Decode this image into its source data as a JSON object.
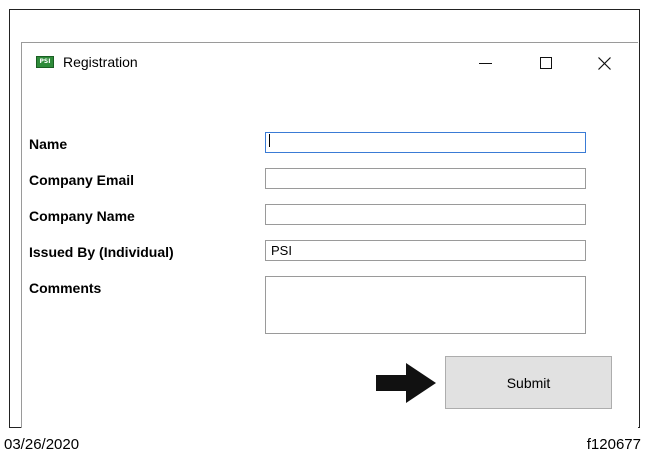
{
  "window": {
    "title": "Registration",
    "icon": "psi-app-icon",
    "icon_text": "PSI",
    "controls": {
      "minimize": "minimize-icon",
      "maximize": "maximize-icon",
      "close": "close-icon",
      "close_glyph": "✕"
    }
  },
  "form": {
    "fields": [
      {
        "label": "Name",
        "value": "",
        "focused": true
      },
      {
        "label": "Company Email",
        "value": ""
      },
      {
        "label": "Company Name",
        "value": ""
      },
      {
        "label": "Issued By (Individual)",
        "value": "PSI"
      },
      {
        "label": "Comments",
        "value": "",
        "multiline": true
      }
    ],
    "submit_label": "Submit"
  },
  "caption": {
    "date": "03/26/2020",
    "figure_id": "f120677"
  },
  "colors": {
    "focus_border": "#3a7bd5",
    "button_bg": "#e1e1e1",
    "icon_green": "#2e8b3a"
  }
}
